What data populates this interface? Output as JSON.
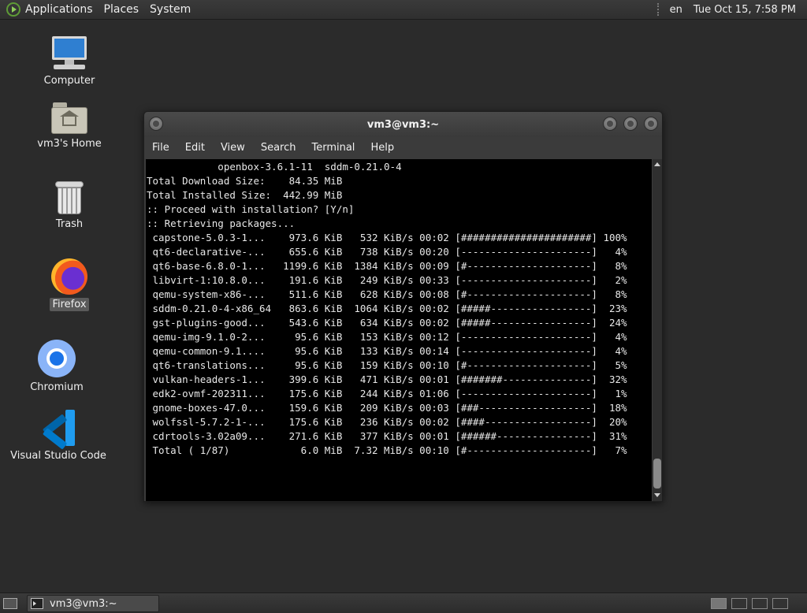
{
  "top_panel": {
    "menus": [
      "Applications",
      "Places",
      "System"
    ],
    "keyboard_layout": "en",
    "datetime": "Tue Oct 15,  7:58 PM"
  },
  "desktop_icons": [
    {
      "label": "Computer",
      "icon": "computer-icon"
    },
    {
      "label": "vm3's Home",
      "icon": "home-folder-icon"
    },
    {
      "label": "Trash",
      "icon": "trash-icon"
    },
    {
      "label": "Firefox",
      "icon": "firefox-icon",
      "selected": true
    },
    {
      "label": "Chromium",
      "icon": "chromium-icon"
    },
    {
      "label": "Visual Studio Code",
      "icon": "vscode-icon"
    }
  ],
  "terminal_window": {
    "title": "vm3@vm3:~",
    "menu": [
      "File",
      "Edit",
      "View",
      "Search",
      "Terminal",
      "Help"
    ],
    "lines": [
      "            openbox-3.6.1-11  sddm-0.21.0-4",
      "",
      "Total Download Size:    84.35 MiB",
      "Total Installed Size:  442.99 MiB",
      "",
      ":: Proceed with installation? [Y/n]",
      ":: Retrieving packages...",
      " capstone-5.0.3-1...    973.6 KiB   532 KiB/s 00:02 [######################] 100%",
      " qt6-declarative-...    655.6 KiB   738 KiB/s 00:20 [----------------------]   4%",
      " qt6-base-6.8.0-1...   1199.6 KiB  1384 KiB/s 00:09 [#---------------------]   8%",
      " libvirt-1:10.8.0...    191.6 KiB   249 KiB/s 00:33 [----------------------]   2%",
      " qemu-system-x86-...    511.6 KiB   628 KiB/s 00:08 [#---------------------]   8%",
      " sddm-0.21.0-4-x86_64   863.6 KiB  1064 KiB/s 00:02 [#####-----------------]  23%",
      " gst-plugins-good...    543.6 KiB   634 KiB/s 00:02 [#####-----------------]  24%",
      " qemu-img-9.1.0-2...     95.6 KiB   153 KiB/s 00:12 [----------------------]   4%",
      " qemu-common-9.1....     95.6 KiB   133 KiB/s 00:14 [----------------------]   4%",
      " qt6-translations...     95.6 KiB   159 KiB/s 00:10 [#---------------------]   5%",
      " vulkan-headers-1...    399.6 KiB   471 KiB/s 00:01 [#######---------------]  32%",
      " edk2-ovmf-202311...    175.6 KiB   244 KiB/s 01:06 [----------------------]   1%",
      " gnome-boxes-47.0...    159.6 KiB   209 KiB/s 00:03 [###-------------------]  18%",
      " wolfssl-5.7.2-1-...    175.6 KiB   236 KiB/s 00:02 [####------------------]  20%",
      " cdrtools-3.02a09...    271.6 KiB   377 KiB/s 00:01 [######----------------]  31%",
      " Total ( 1/87)            6.0 MiB  7.32 MiB/s 00:10 [#---------------------]   7%"
    ]
  },
  "taskbar": {
    "tasks": [
      {
        "label": "vm3@vm3:~",
        "icon": "terminal-icon"
      }
    ]
  }
}
